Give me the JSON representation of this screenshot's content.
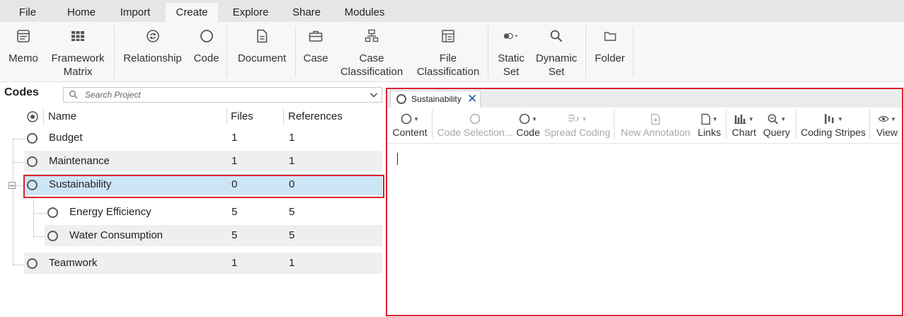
{
  "menu": {
    "tabs": [
      {
        "label": "File"
      },
      {
        "label": "Home"
      },
      {
        "label": "Import"
      },
      {
        "label": "Create"
      },
      {
        "label": "Explore"
      },
      {
        "label": "Share"
      },
      {
        "label": "Modules"
      }
    ],
    "active_tab": "Create"
  },
  "ribbon": {
    "memo": {
      "label": "Memo",
      "icon": "memo-icon"
    },
    "framework_matrix": {
      "label": "Framework\nMatrix",
      "icon": "framework-matrix-icon"
    },
    "relationship": {
      "label": "Relationship",
      "icon": "relationship-icon"
    },
    "code": {
      "label": "Code",
      "icon": "code-circle-icon"
    },
    "document": {
      "label": "Document",
      "icon": "document-icon"
    },
    "case": {
      "label": "Case",
      "icon": "case-briefcase-icon"
    },
    "case_classification": {
      "label": "Case\nClassification",
      "icon": "case-classification-icon"
    },
    "file_classification": {
      "label": "File\nClassification",
      "icon": "file-classification-icon"
    },
    "static_set": {
      "label": "Static\nSet",
      "icon": "static-set-icon"
    },
    "dynamic_set": {
      "label": "Dynamic\nSet",
      "icon": "dynamic-set-search-icon"
    },
    "folder": {
      "label": "Folder",
      "icon": "folder-icon"
    }
  },
  "codes": {
    "title": "Codes",
    "search_placeholder": "Search Project",
    "columns": {
      "name": "Name",
      "files": "Files",
      "references": "References"
    },
    "rows": [
      {
        "name": "Budget",
        "files": "1",
        "references": "1"
      },
      {
        "name": "Maintenance",
        "files": "1",
        "references": "1"
      },
      {
        "name": "Sustainability",
        "files": "0",
        "references": "0"
      },
      {
        "name": "Energy Efficiency",
        "files": "5",
        "references": "5"
      },
      {
        "name": "Water Consumption",
        "files": "5",
        "references": "5"
      },
      {
        "name": "Teamwork",
        "files": "1",
        "references": "1"
      }
    ],
    "selected": "Sustainability"
  },
  "document": {
    "tab_title": "Sustainability",
    "toolbar": {
      "content": "Content",
      "code_selection": "Code Selection...",
      "code": "Code",
      "spread_coding": "Spread Coding",
      "new_annotation": "New Annotation",
      "links": "Links",
      "chart": "Chart",
      "query": "Query",
      "coding_stripes": "Coding Stripes",
      "view": "View"
    }
  },
  "colors": {
    "highlight_border": "#d9232e",
    "selected_row": "#cde6f7",
    "close_x": "#1a5aa8"
  }
}
